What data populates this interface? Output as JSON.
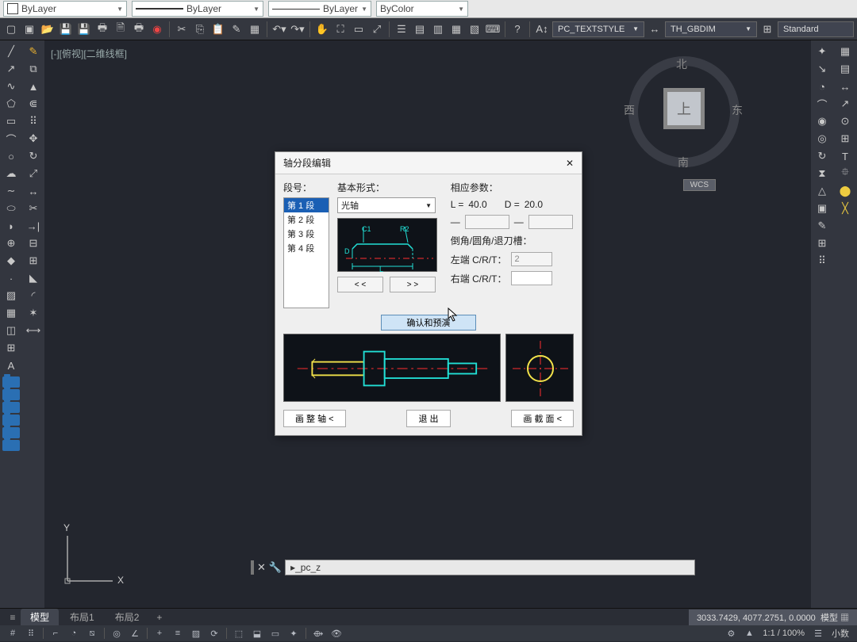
{
  "properties": {
    "color_label": "ByLayer",
    "linetype_label": "ByLayer",
    "lineweight_label": "ByLayer",
    "plotstyle_label": "ByColor"
  },
  "toolbar": {
    "textstyle": "PC_TEXTSTYLE",
    "dimstyle": "TH_GBDIM",
    "tablestyle": "Standard"
  },
  "view": {
    "label": "[-][俯视][二维线框]",
    "cube": {
      "n": "北",
      "s": "南",
      "e": "东",
      "w": "西",
      "top": "上"
    },
    "wcs": "WCS",
    "axes": {
      "x": "X",
      "y": "Y"
    }
  },
  "dialog": {
    "title": "轴分段编辑",
    "segment_label": "段号：",
    "segments": [
      "第 1 段",
      "第 2 段",
      "第 3 段",
      "第 4 段"
    ],
    "basic_form_label": "基本形式：",
    "basic_form_value": "光轴",
    "preview_markers": {
      "c1": "C1",
      "r2": "R2",
      "d": "D",
      "l": "L"
    },
    "prev_btn": "< <",
    "next_btn": "> >",
    "params_label": "相应参数：",
    "L_label": "L =",
    "L_value": "40.0",
    "D_label": "D =",
    "D_value": "20.0",
    "dash_label": "—",
    "chamfer_label": "倒角/圆角/退刀槽：",
    "left_crt_label": "左端 C/R/T：",
    "left_crt_value": "2",
    "right_crt_label": "右端 C/R/T：",
    "right_crt_value": "",
    "confirm_btn": "确认和预演",
    "whole_shaft_btn": "画 整 轴 <",
    "exit_btn": "退 出",
    "section_btn": "画 截 面 <",
    "close_btn": "✕"
  },
  "tabs": {
    "model": "模型",
    "layout1": "布局1",
    "layout2": "布局2"
  },
  "coords": "3033.7429, 4077.2751, 0.0000",
  "mode": "模型",
  "command": {
    "prompt": "▸_pc_z"
  },
  "bottom": {
    "zoom": "1:1 / 100%",
    "precision": "小数"
  }
}
